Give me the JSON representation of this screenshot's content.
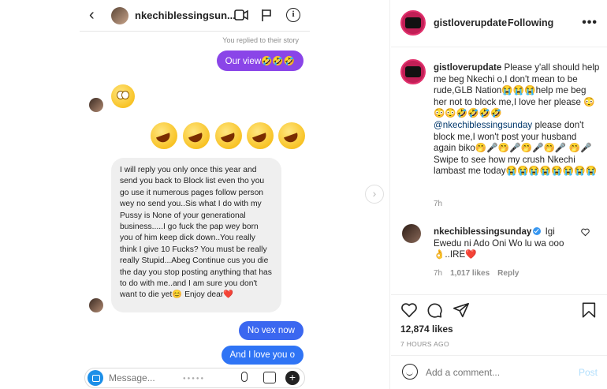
{
  "dm": {
    "username": "nkechiblessingsun...",
    "story_reply_note": "You replied to their story",
    "messages_out": [
      "Our view🤣🤣🤣",
      "No vex now",
      "And I love you o"
    ],
    "emoji_received": "🙄",
    "emoji_row": "🤣🤣🤣🤣🤣",
    "long_message": "I will reply you only once this year and send you back to Block list even tho you go use it numerous pages follow person wey no send you..Sis what I do with my Pussy is None of your generational business.....I go fuck the pap wey born you of him keep dick down..You really think I give 10 Fucks? You must be really really Stupid...Abeg Continue cus you die the day you stop posting anything that has to do with me..and I am sure you don't want to die yet😊 Enjoy dear❤️",
    "input_placeholder": "Message..."
  },
  "post": {
    "username": "gistloverupdate",
    "follow_status": "Following",
    "more": "•••",
    "caption_user": "gistloverupdate",
    "caption_part1": " Please y'all should help me beg Nkechi o,I don't mean to be rude,GLB Nation😭😭😭help me beg her not to block me,I love her please 😳😳😳🤣🤣🤣🤣 ",
    "caption_mention": "@nkechiblessingsunday",
    "caption_part2": " please don't block me,I won't post your husband again biko🤭🎤🤭🎤🤭🎤🤭🎤 🤭🎤Swipe to see how my crush Nkechi lambast me today😭😭😭😭😭😭😭😭",
    "caption_time": "7h",
    "comment_user": "nkechiblessingsunday",
    "comment_text": " Igi Ewedu ni Ado Oni Wo lu wa ooo 👌..IRE❤️",
    "comment_time": "7h",
    "comment_likes": "1,017 likes",
    "comment_reply": "Reply",
    "likes": "12,874 likes",
    "age": "7 HOURS AGO",
    "add_comment_placeholder": "Add a comment...",
    "post_button": "Post"
  }
}
